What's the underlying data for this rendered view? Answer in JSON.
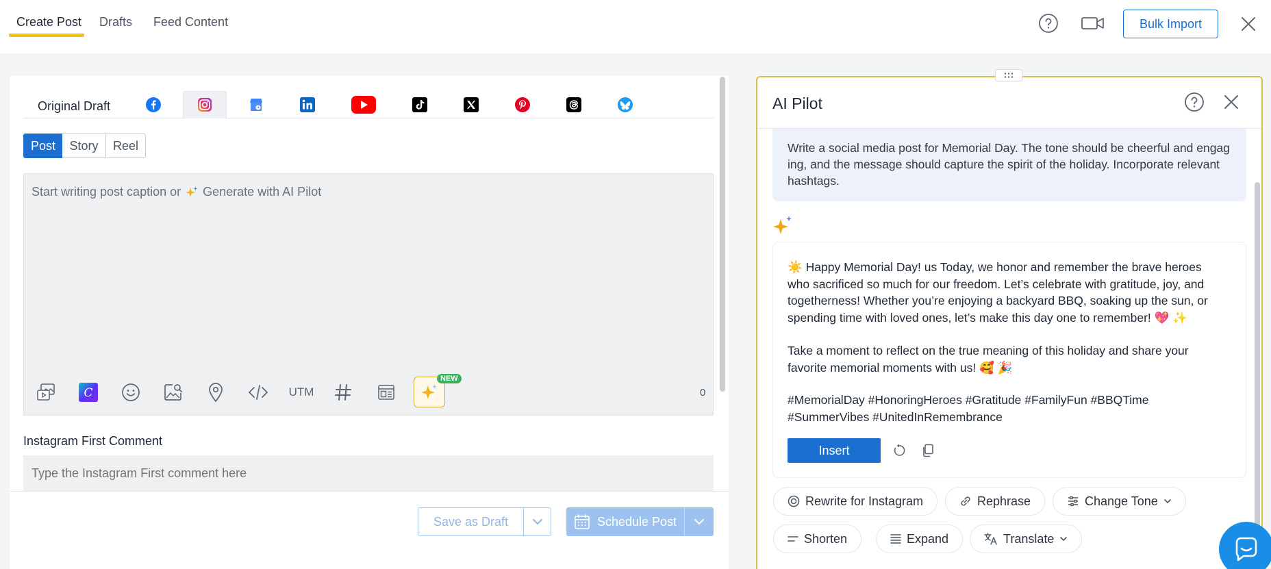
{
  "top_nav": {
    "tabs": [
      {
        "label": "Create Post",
        "active": true
      },
      {
        "label": "Drafts",
        "active": false
      },
      {
        "label": "Feed Content",
        "active": false
      }
    ],
    "bulk_import_label": "Bulk Import",
    "icons": [
      "help-icon",
      "video-icon",
      "close-icon"
    ]
  },
  "editor": {
    "original_draft_label": "Original Draft",
    "platforms": [
      "facebook",
      "instagram",
      "google-business",
      "linkedin",
      "youtube",
      "tiktok",
      "x",
      "pinterest",
      "threads",
      "bluesky"
    ],
    "selected_platform": "instagram",
    "post_types": [
      {
        "label": "Post",
        "active": true
      },
      {
        "label": "Story",
        "active": false
      },
      {
        "label": "Reel",
        "active": false
      }
    ],
    "caption_placeholder": "Start writing post caption or",
    "generate_ai_label": "Generate with AI Pilot",
    "utm_label": "UTM",
    "new_badge": "NEW",
    "char_count": "0",
    "first_comment_label": "Instagram First Comment",
    "first_comment_placeholder": "Type the Instagram First comment here",
    "save_draft_label": "Save as Draft",
    "schedule_label": "Schedule Post"
  },
  "ai_pilot": {
    "title": "AI Pilot",
    "prompt": "Write a social media post for Memorial Day. The tone should be cheerful and engag ing, and the message should capture the spirit of the holiday. Incorporate relevant hashtags.",
    "response": {
      "para1": "☀️ Happy Memorial Day! us Today, we honor and remember the brave heroes who sacrificed so much for our freedom. Let’s celebrate with gratitude, joy, and togetherness! Whether you’re enjoying a backyard BBQ, soaking up the sun, or spending time with loved ones, let’s make this day one to remember! 💖 ✨",
      "para2": "Take a moment to reflect on the true meaning of this holiday and share your favorite memorial moments with us! 🥰 🎉",
      "para3": "#MemorialDay #HonoringHeroes #Gratitude #FamilyFun #BBQTime #SummerVibes #UnitedInRemembrance"
    },
    "insert_label": "Insert",
    "actions": [
      {
        "label": "Rewrite for Instagram",
        "icon": "instagram-outline-icon"
      },
      {
        "label": "Rephrase",
        "icon": "link-icon"
      },
      {
        "label": "Change Tone",
        "icon": "sliders-icon",
        "dropdown": true
      },
      {
        "label": "Shorten",
        "icon": "shorten-icon"
      },
      {
        "label": "Expand",
        "icon": "expand-icon"
      },
      {
        "label": "Translate",
        "icon": "translate-icon",
        "dropdown": true
      }
    ]
  },
  "colors": {
    "primary": "#1a6fd1",
    "accent_yellow": "#f0c419",
    "ai_border": "#d6c04a",
    "prompt_bg": "#ecf1fb"
  }
}
